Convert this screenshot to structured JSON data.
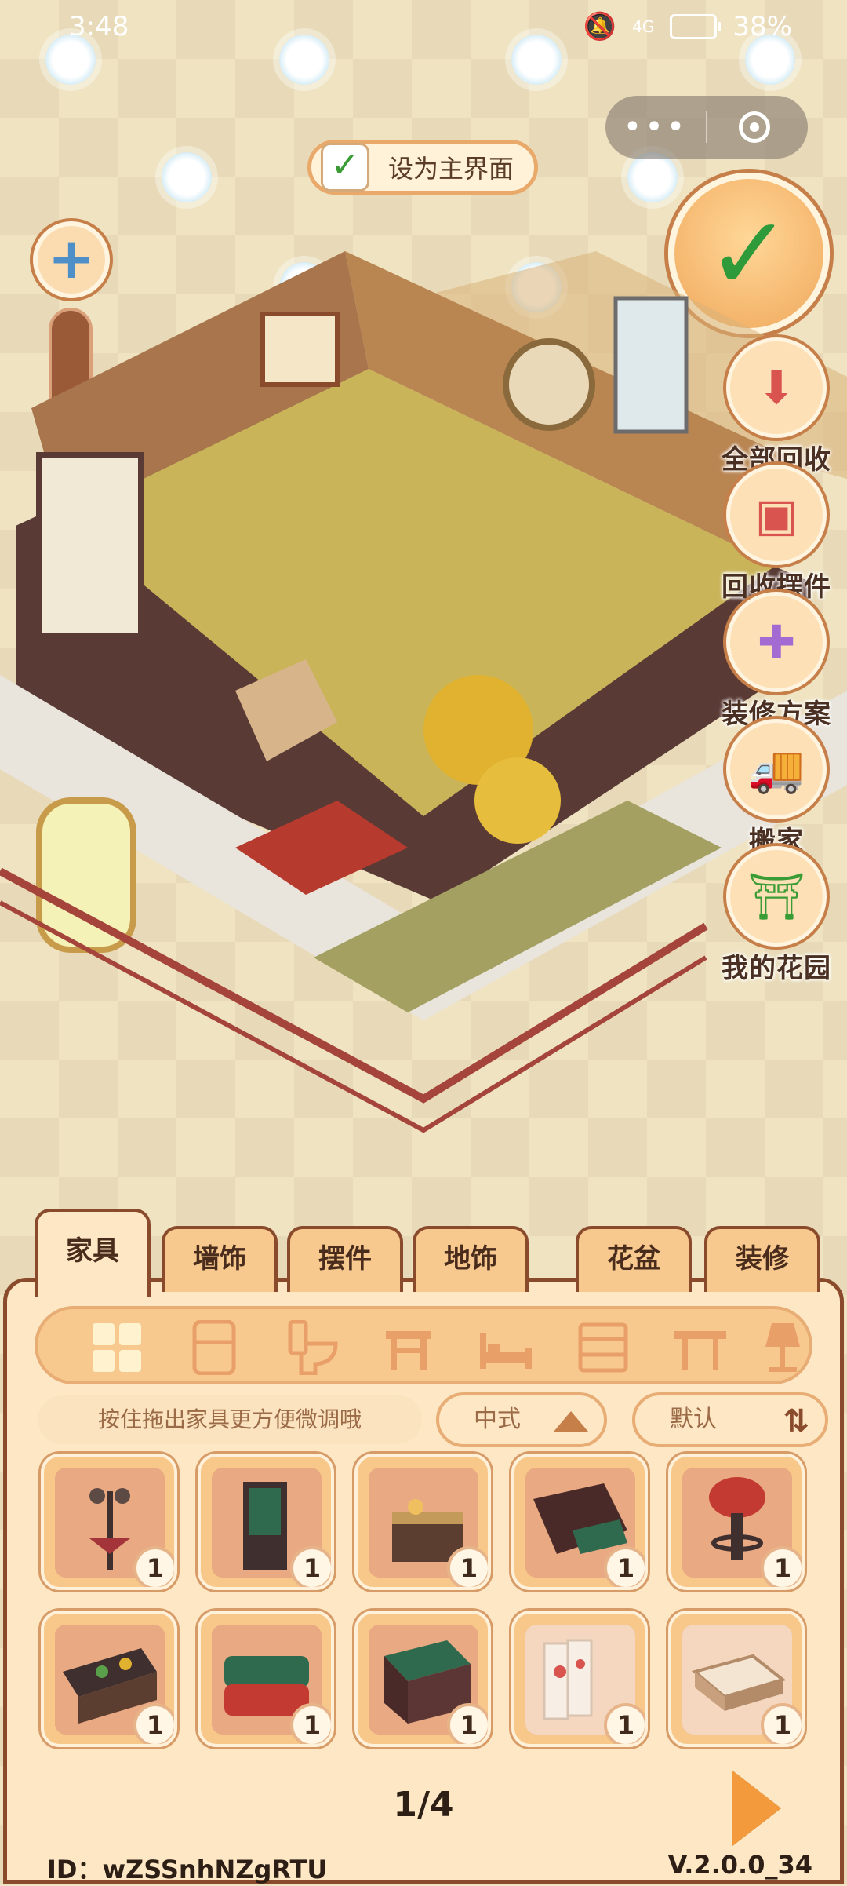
{
  "status_bar": {
    "time": "3:48",
    "network": "4G",
    "battery": "38%"
  },
  "home_button": {
    "label": "设为主界面",
    "checked": true
  },
  "side_actions": [
    {
      "label": "全部回收",
      "icon": "box-down-icon"
    },
    {
      "label": "回收摆件",
      "icon": "recycle-box-icon"
    },
    {
      "label": "装修方案",
      "icon": "plan-card-icon"
    },
    {
      "label": "搬家",
      "icon": "moving-truck-icon"
    },
    {
      "label": "我的花园",
      "icon": "garden-gate-icon"
    }
  ],
  "tabs": [
    {
      "label": "家具",
      "active": true
    },
    {
      "label": "墙饰",
      "active": false
    },
    {
      "label": "摆件",
      "active": false
    },
    {
      "label": "地饰",
      "active": false
    },
    {
      "label": "花盆",
      "active": false
    },
    {
      "label": "装修",
      "active": false
    }
  ],
  "categories": [
    "all-grid-icon",
    "fridge-icon",
    "toilet-icon",
    "stool-icon",
    "bed-icon",
    "cabinet-icon",
    "table-icon",
    "lamp-icon"
  ],
  "hint": "按住拖出家具更方便微调哦",
  "style_filter": "中式",
  "sort_filter": "默认",
  "items": [
    {
      "name": "street-lamp",
      "count": "1"
    },
    {
      "name": "folding-screen",
      "count": "1"
    },
    {
      "name": "food-stall",
      "count": "1"
    },
    {
      "name": "sofa-green",
      "count": "1"
    },
    {
      "name": "red-bar-stool",
      "count": "1"
    },
    {
      "name": "vegetable-counter",
      "count": "1"
    },
    {
      "name": "red-green-sofa",
      "count": "1"
    },
    {
      "name": "carved-cabinet",
      "count": "1"
    },
    {
      "name": "maple-screen",
      "count": "1"
    },
    {
      "name": "tea-table",
      "count": "1"
    }
  ],
  "pager": "1/4",
  "footer": {
    "id": "ID：wZSSnhNZgRTU",
    "version": "V.2.0.0_34"
  }
}
